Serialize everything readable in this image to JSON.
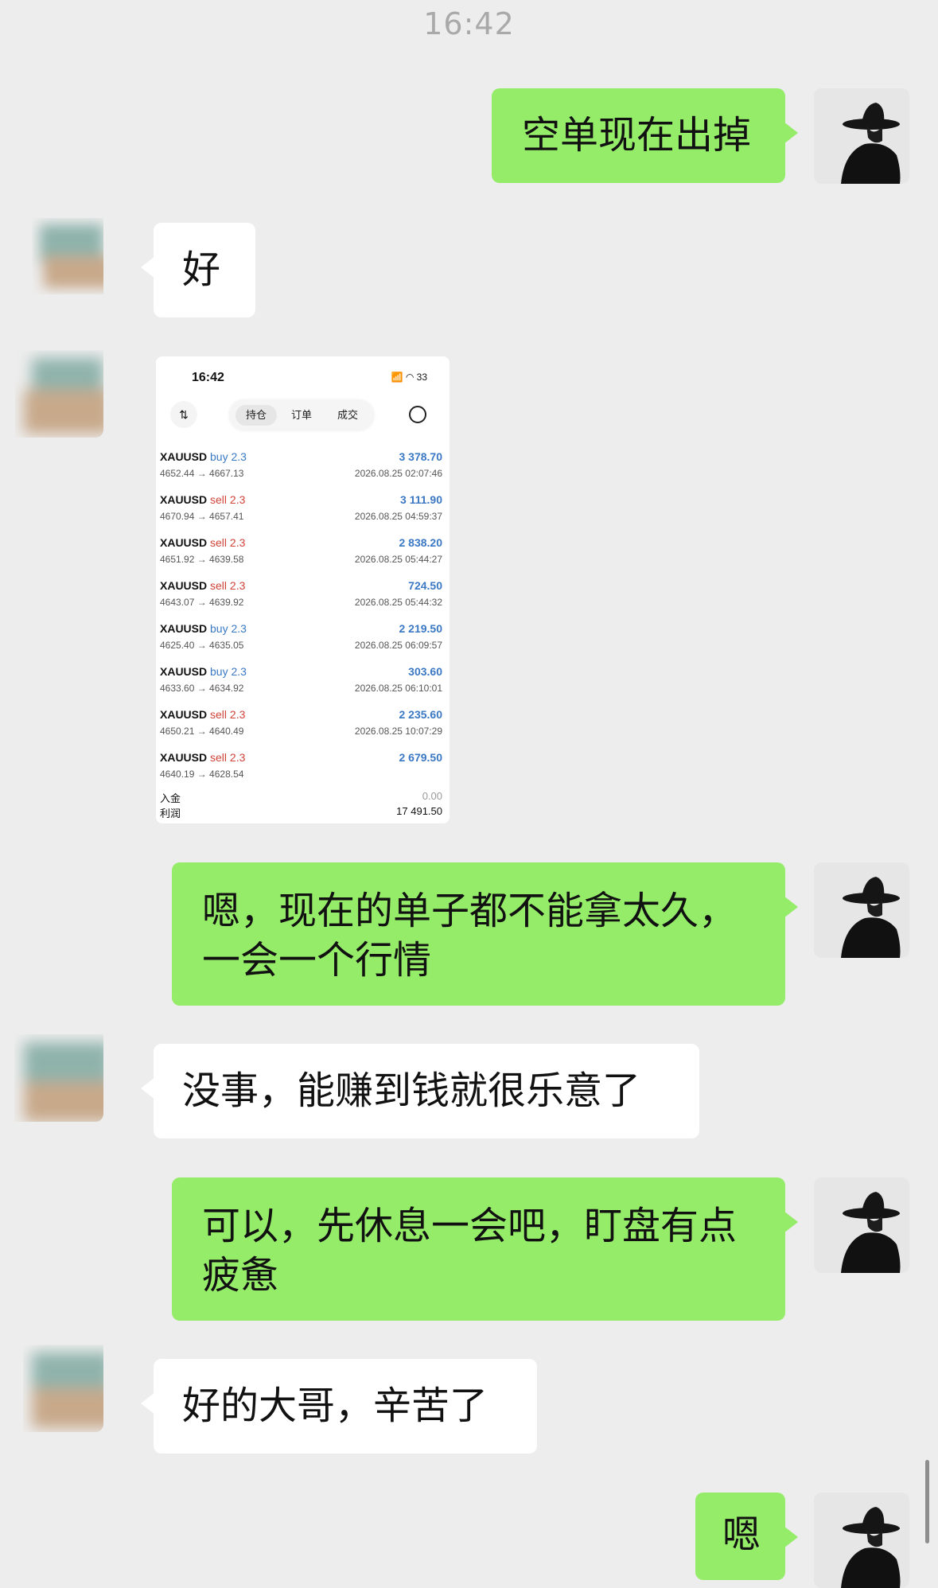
{
  "header": {
    "time": "16:42"
  },
  "messages": [
    {
      "from": "me",
      "text": "空单现在出掉"
    },
    {
      "from": "other",
      "text": "好"
    },
    {
      "from": "other",
      "type": "image"
    },
    {
      "from": "me",
      "text": "嗯，现在的单子都不能拿太久，一会一个行情"
    },
    {
      "from": "other",
      "text": "没事，能赚到钱就很乐意了"
    },
    {
      "from": "me",
      "text": "可以，先休息一会吧，盯盘有点疲惫"
    },
    {
      "from": "other",
      "text": "好的大哥，辛苦了"
    },
    {
      "from": "me",
      "text": "嗯"
    }
  ],
  "screenshot": {
    "time": "16:42",
    "status": "📶 ◠ 33",
    "tabs": [
      "持仓",
      "订单",
      "成交"
    ],
    "active_tab": "持仓",
    "trades": [
      {
        "symbol": "XAUUSD",
        "side": "buy",
        "lot": "2.3",
        "prices": "4652.44 → 4667.13",
        "profit": "3 378.70",
        "time": "2026.08.25 02:07:46"
      },
      {
        "symbol": "XAUUSD",
        "side": "sell",
        "lot": "2.3",
        "prices": "4670.94 → 4657.41",
        "profit": "3 111.90",
        "time": "2026.08.25 04:59:37"
      },
      {
        "symbol": "XAUUSD",
        "side": "sell",
        "lot": "2.3",
        "prices": "4651.92 → 4639.58",
        "profit": "2 838.20",
        "time": "2026.08.25 05:44:27"
      },
      {
        "symbol": "XAUUSD",
        "side": "sell",
        "lot": "2.3",
        "prices": "4643.07 → 4639.92",
        "profit": "724.50",
        "time": "2026.08.25 05:44:32"
      },
      {
        "symbol": "XAUUSD",
        "side": "buy",
        "lot": "2.3",
        "prices": "4625.40 → 4635.05",
        "profit": "2 219.50",
        "time": "2026.08.25 06:09:57"
      },
      {
        "symbol": "XAUUSD",
        "side": "buy",
        "lot": "2.3",
        "prices": "4633.60 → 4634.92",
        "profit": "303.60",
        "time": "2026.08.25 06:10:01"
      },
      {
        "symbol": "XAUUSD",
        "side": "sell",
        "lot": "2.3",
        "prices": "4650.21 → 4640.49",
        "profit": "2 235.60",
        "time": "2026.08.25 10:07:29"
      },
      {
        "symbol": "XAUUSD",
        "side": "sell",
        "lot": "2.3",
        "prices": "4640.19 → 4628.54",
        "profit": "2 679.50",
        "time": ""
      }
    ],
    "deposit_label": "入金",
    "deposit_value": "0.00",
    "profit_label": "利润",
    "profit_value": "17 491.50"
  }
}
